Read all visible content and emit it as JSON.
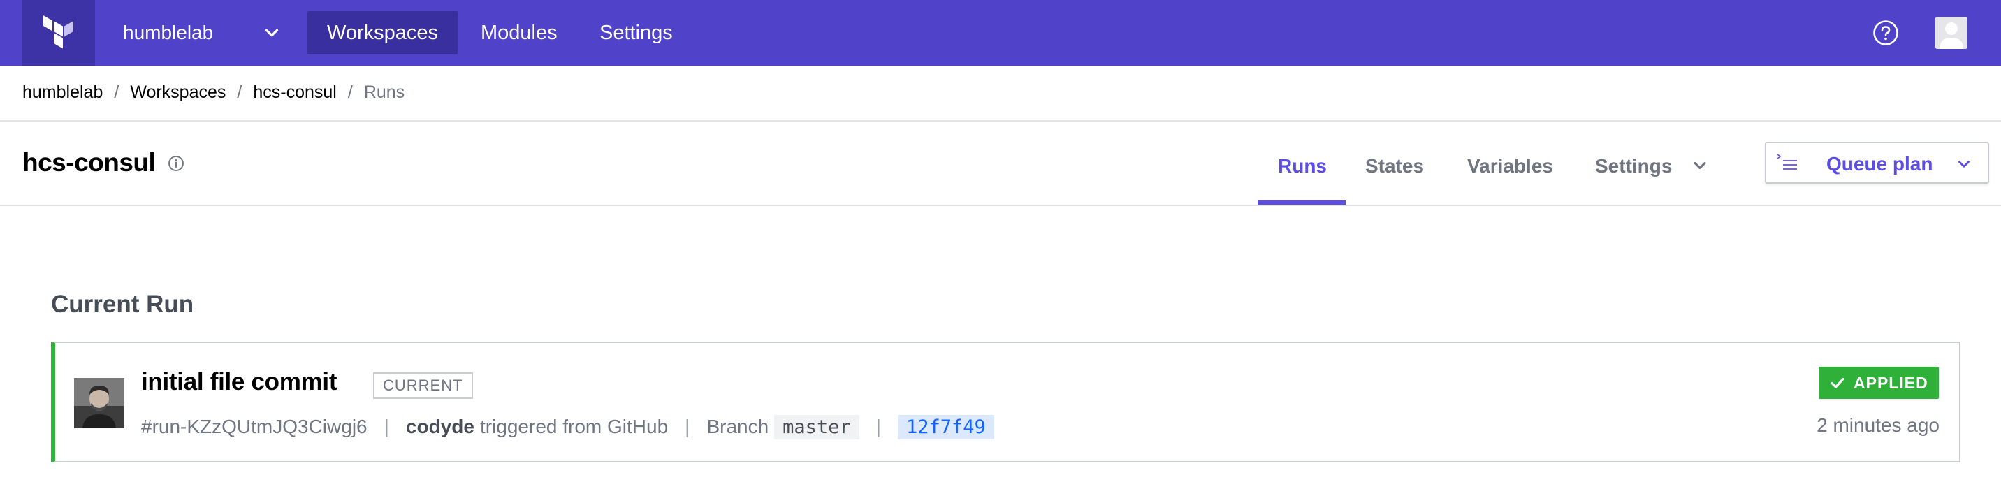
{
  "topnav": {
    "org_name": "humblelab",
    "items": [
      {
        "label": "Workspaces",
        "active": true
      },
      {
        "label": "Modules",
        "active": false
      },
      {
        "label": "Settings",
        "active": false
      }
    ],
    "help_icon": "question-circle-icon",
    "avatar_icon": "user-avatar-icon"
  },
  "breadcrumb": {
    "items": [
      "humblelab",
      "Workspaces",
      "hcs-consul"
    ],
    "current": "Runs",
    "separator": "/"
  },
  "workspace": {
    "name": "hcs-consul",
    "tabs": [
      {
        "label": "Runs",
        "active": true
      },
      {
        "label": "States",
        "active": false
      },
      {
        "label": "Variables",
        "active": false
      },
      {
        "label": "Settings",
        "active": false
      }
    ],
    "queue_plan_label": "Queue plan"
  },
  "current_run": {
    "section_title": "Current Run",
    "title": "initial file commit",
    "badge": "CURRENT",
    "run_id": "#run-KZzQUtmJQ3Ciwgj6",
    "user": "codyde",
    "trigger_text": "triggered from GitHub",
    "branch_label": "Branch",
    "branch": "master",
    "commit": "12f7f49",
    "status": "APPLIED",
    "time": "2 minutes ago",
    "meta_separator": "|"
  },
  "colors": {
    "nav_bg": "#5043c9",
    "accent": "#5c4ee5",
    "success": "#2eb039",
    "commit_link": "#1563ff"
  }
}
